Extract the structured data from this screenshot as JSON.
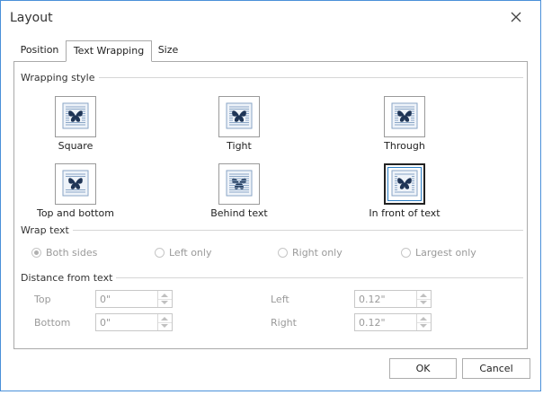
{
  "dialog": {
    "title": "Layout"
  },
  "tabs": [
    {
      "label": "Position"
    },
    {
      "label": "Text Wrapping"
    },
    {
      "label": "Size"
    }
  ],
  "wrapping_style": {
    "heading": "Wrapping style",
    "options": [
      {
        "label": "Square",
        "icon": "wrap-square-icon"
      },
      {
        "label": "Tight",
        "icon": "wrap-tight-icon"
      },
      {
        "label": "Through",
        "icon": "wrap-through-icon"
      },
      {
        "label": "Top and bottom",
        "icon": "wrap-top-bottom-icon"
      },
      {
        "label": "Behind text",
        "icon": "wrap-behind-text-icon"
      },
      {
        "label": "In front of text",
        "icon": "wrap-in-front-icon"
      }
    ],
    "selected": "In front of text"
  },
  "wrap_text": {
    "heading": "Wrap text",
    "options": [
      {
        "label": "Both sides"
      },
      {
        "label": "Left only"
      },
      {
        "label": "Right only"
      },
      {
        "label": "Largest only"
      }
    ],
    "selected": "Both sides"
  },
  "distance": {
    "heading": "Distance from text",
    "top": {
      "label": "Top",
      "value": "0\""
    },
    "bottom": {
      "label": "Bottom",
      "value": "0\""
    },
    "left": {
      "label": "Left",
      "value": "0.12\""
    },
    "right": {
      "label": "Right",
      "value": "0.12\""
    }
  },
  "footer": {
    "ok_label": "OK",
    "cancel_label": "Cancel"
  },
  "colors": {
    "accent": "#2d7fc4",
    "border": "#4a90d9",
    "icon_dark": "#1f3556",
    "text_lines": "#8aa6c6"
  }
}
